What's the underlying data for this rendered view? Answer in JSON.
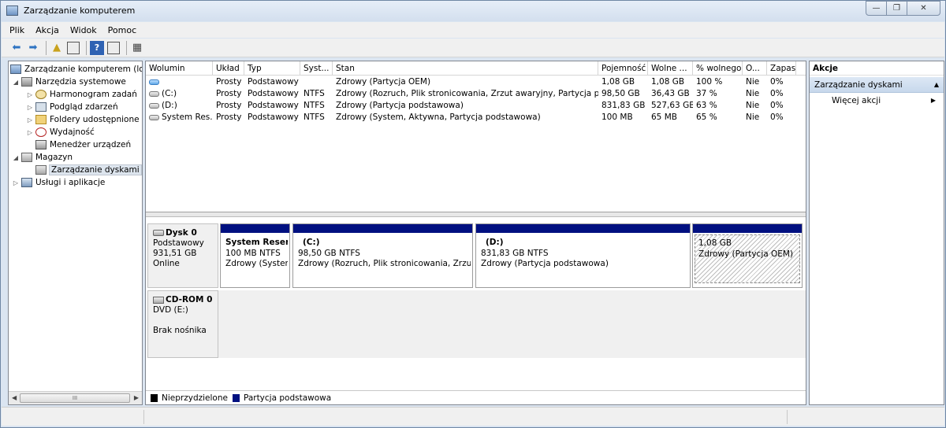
{
  "window": {
    "title": "Zarządzanie komputerem"
  },
  "menu": [
    "Plik",
    "Akcja",
    "Widok",
    "Pomoc"
  ],
  "toolbar": {
    "icons": [
      "back-arrow-icon",
      "forward-arrow-icon",
      "up-folder-icon",
      "show-hide-tree-icon",
      "help-icon",
      "show-hide-action-pane-icon",
      "properties-icon"
    ],
    "help_label": "?"
  },
  "tree": {
    "root": "Zarządzanie komputerem (lokalne)",
    "items": [
      {
        "label": "Narzędzia systemowe",
        "level": 1,
        "expander": "◢"
      },
      {
        "label": "Harmonogram zadań",
        "level": 2,
        "expander": "▷"
      },
      {
        "label": "Podgląd zdarzeń",
        "level": 2,
        "expander": "▷"
      },
      {
        "label": "Foldery udostępnione",
        "level": 2,
        "expander": "▷"
      },
      {
        "label": "Wydajność",
        "level": 2,
        "expander": "▷"
      },
      {
        "label": "Menedżer urządzeń",
        "level": 2,
        "expander": ""
      },
      {
        "label": "Magazyn",
        "level": 1,
        "expander": "◢"
      },
      {
        "label": "Zarządzanie dyskami",
        "level": 2,
        "expander": ""
      },
      {
        "label": "Usługi i aplikacje",
        "level": 1,
        "expander": "▷"
      }
    ],
    "scroll_thumb": "III"
  },
  "volumes": {
    "headers": [
      "Wolumin",
      "Układ",
      "Typ",
      "Syst...",
      "Stan",
      "Pojemność",
      "Wolne ...",
      "% wolnego",
      "O...",
      "Zapas"
    ],
    "rows": [
      [
        "",
        "Prosty",
        "Podstawowy",
        "",
        "Zdrowy (Partycja OEM)",
        "1,08 GB",
        "1,08 GB",
        "100 %",
        "Nie",
        "0%"
      ],
      [
        "(C:)",
        "Prosty",
        "Podstawowy",
        "NTFS",
        "Zdrowy (Rozruch, Plik stronicowania, Zrzut awaryjny, Partycja pods...",
        "98,50 GB",
        "36,43 GB",
        "37 %",
        "Nie",
        "0%"
      ],
      [
        "(D:)",
        "Prosty",
        "Podstawowy",
        "NTFS",
        "Zdrowy (Partycja podstawowa)",
        "831,83 GB",
        "527,63 GB",
        "63 %",
        "Nie",
        "0%"
      ],
      [
        "System Res...",
        "Prosty",
        "Podstawowy",
        "NTFS",
        "Zdrowy (System, Aktywna, Partycja podstawowa)",
        "100 MB",
        "65 MB",
        "65 %",
        "Nie",
        "0%"
      ]
    ]
  },
  "disk0": {
    "name": "Dysk 0",
    "type": "Podstawowy",
    "size": "931,51 GB",
    "status": "Online",
    "partitions": [
      {
        "name": "System Reserve",
        "size": "100 MB NTFS",
        "status": "Zdrowy (System,",
        "oem": false
      },
      {
        "name": "(C:)",
        "size": "98,50 GB NTFS",
        "status": "Zdrowy (Rozruch, Plik stronicowania, Zrzut aw",
        "oem": false
      },
      {
        "name": "(D:)",
        "size": "831,83 GB NTFS",
        "status": "Zdrowy (Partycja podstawowa)",
        "oem": false
      },
      {
        "name": "",
        "size": "1,08 GB",
        "status": "Zdrowy (Partycja OEM)",
        "oem": true
      }
    ]
  },
  "cdrom0": {
    "name": "CD-ROM 0",
    "type": "DVD (E:)",
    "status": "Brak nośnika"
  },
  "legend": [
    {
      "label": "Nieprzydzielone",
      "color": "#000000"
    },
    {
      "label": "Partycja podstawowa",
      "color": "#001080"
    }
  ],
  "actions": {
    "title": "Akcje",
    "section": "Zarządzanie dyskami",
    "items": [
      "Więcej akcji"
    ]
  }
}
